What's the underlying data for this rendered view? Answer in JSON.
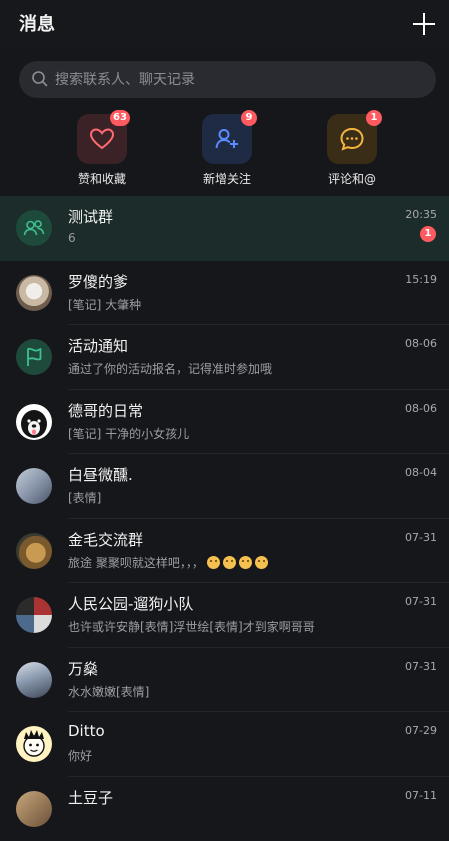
{
  "header": {
    "title": "消息"
  },
  "search": {
    "placeholder": "搜索联系人、聊天记录"
  },
  "quick_actions": [
    {
      "label": "赞和收藏",
      "badge": "63",
      "icon": "heart-icon",
      "color": "#ff6b70"
    },
    {
      "label": "新增关注",
      "badge": "9",
      "icon": "add-user-icon",
      "color": "#5b8cff"
    },
    {
      "label": "评论和@",
      "badge": "1",
      "icon": "comment-icon",
      "color": "#f5b53d"
    }
  ],
  "conversations": [
    {
      "name": "测试群",
      "message": "6",
      "time": "20:35",
      "unread": "1",
      "avatar": "group-icon"
    },
    {
      "name": "罗傻的爹",
      "message": "[笔记] 大肇种",
      "time": "15:19",
      "avatar": "cat-photo"
    },
    {
      "name": "活动通知",
      "message": "通过了你的活动报名，记得准时参加哦",
      "time": "08-06",
      "avatar": "flag-icon"
    },
    {
      "name": "德哥的日常",
      "message": "[笔记] 干净的小女孩儿",
      "time": "08-06",
      "avatar": "dog-photo"
    },
    {
      "name": "白昼微醺.",
      "message": "[表情]",
      "time": "08-04",
      "avatar": "person-photo"
    },
    {
      "name": "金毛交流群",
      "message": "旅途   聚聚呗就这样吧，，，",
      "time": "07-31",
      "avatar": "golden-dog-photo"
    },
    {
      "name": "人民公园-遛狗小队",
      "message": "也许或许安静[表情]浮世绘[表情]才到家啊哥哥",
      "time": "07-31",
      "avatar": "collage-photo"
    },
    {
      "name": "万燊",
      "message": "水水嫩嫩[表情]",
      "time": "07-31",
      "avatar": "person-photo"
    },
    {
      "name": "Ditto",
      "message": "你好",
      "time": "07-29",
      "avatar": "cartoon-avatar"
    },
    {
      "name": "土豆子",
      "message": "",
      "time": "07-11",
      "avatar": "person-photo"
    }
  ],
  "colors": {
    "background": "#16171b",
    "pinned_row": "#1c2c2a",
    "badge": "#ff5a5f",
    "accent_green": "#3fbf8f"
  }
}
